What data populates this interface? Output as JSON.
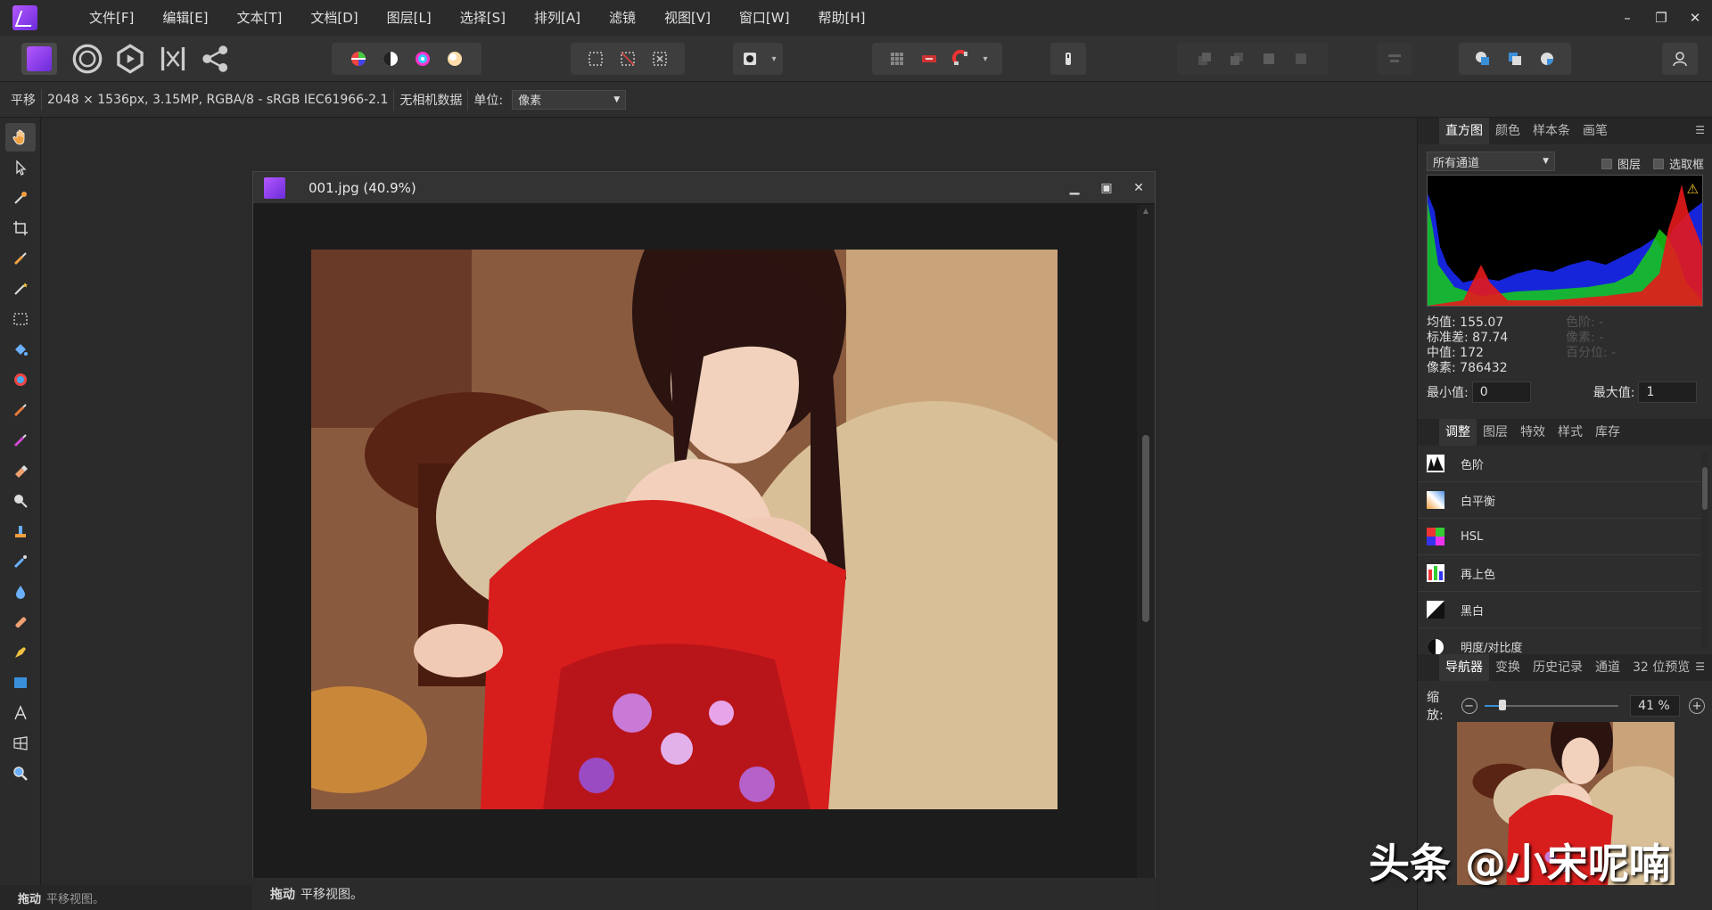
{
  "menubar": {
    "items": [
      "文件[F]",
      "编辑[E]",
      "文本[T]",
      "文档[D]",
      "图层[L]",
      "选择[S]",
      "排列[A]",
      "滤镜",
      "视图[V]",
      "窗口[W]",
      "帮助[H]"
    ],
    "window_controls": [
      "–",
      "❐",
      "✕"
    ]
  },
  "context": {
    "tool_name": "平移",
    "image_info": "2048 × 1536px, 3.15MP, RGBA/8 - sRGB IEC61966-2.1",
    "camera_info": "无相机数据",
    "unit_label": "单位:",
    "unit_value": "像素"
  },
  "document": {
    "title": "001.jpg (40.9%)",
    "status_bold": "拖动",
    "status_text": "平移视图。"
  },
  "statusbar": {
    "bold": "拖动",
    "text": "平移视图。"
  },
  "histogram_panel": {
    "tabs": [
      "直方图",
      "颜色",
      "样本条",
      "画笔"
    ],
    "channel": "所有通道",
    "check_layer": "图层",
    "check_selection": "选取框",
    "mean": "均值: 155.07",
    "std": "标准差: 87.74",
    "median": "中值: 172",
    "pixels": "像素: 786432",
    "levels_dim": "色阶: -",
    "pixels_dim": "像素: -",
    "percent_dim": "百分位: -",
    "min_label": "最小值:",
    "min_value": "0",
    "max_label": "最大值:",
    "max_value": "1"
  },
  "adjust_panel": {
    "tabs": [
      "调整",
      "图层",
      "特效",
      "样式",
      "库存"
    ],
    "items": [
      "色阶",
      "白平衡",
      "HSL",
      "再上色",
      "黑白",
      "明度/对比度"
    ]
  },
  "navigator_panel": {
    "tabs": [
      "导航器",
      "变换",
      "历史记录",
      "通道",
      "32 位预览"
    ],
    "zoom_label": "缩放:",
    "zoom_value": "41 %"
  },
  "watermark": "头条 @小宋呢喃",
  "colors": {
    "accent": "#9b4dff",
    "bg": "#2a2a2a",
    "panel": "#2d2d2d"
  }
}
